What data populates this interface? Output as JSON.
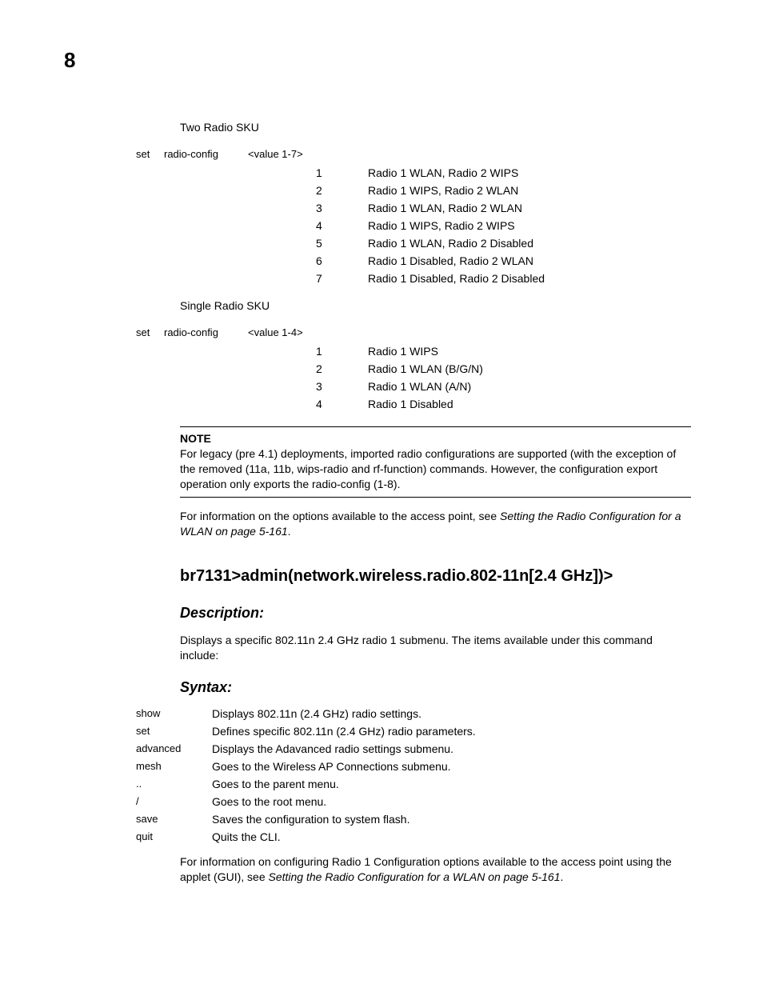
{
  "page_number": "8",
  "section1": {
    "title": "Two Radio SKU",
    "cmd": {
      "set": "set",
      "rc": "radio-config",
      "range": "<value 1-7>"
    },
    "values": [
      {
        "n": "1",
        "d": "Radio 1 WLAN, Radio 2 WIPS"
      },
      {
        "n": "2",
        "d": "Radio 1 WIPS, Radio 2 WLAN"
      },
      {
        "n": "3",
        "d": "Radio 1 WLAN, Radio 2 WLAN"
      },
      {
        "n": "4",
        "d": "Radio 1 WIPS, Radio 2 WIPS"
      },
      {
        "n": "5",
        "d": "Radio 1 WLAN, Radio 2 Disabled"
      },
      {
        "n": "6",
        "d": "Radio 1 Disabled, Radio 2 WLAN"
      },
      {
        "n": "7",
        "d": "Radio 1 Disabled, Radio 2 Disabled"
      }
    ]
  },
  "section2": {
    "title": "Single Radio SKU",
    "cmd": {
      "set": "set",
      "rc": "radio-config",
      "range": "<value 1-4>"
    },
    "values": [
      {
        "n": "1",
        "d": "Radio 1 WIPS"
      },
      {
        "n": "2",
        "d": "Radio 1 WLAN (B/G/N)"
      },
      {
        "n": "3",
        "d": "Radio 1 WLAN (A/N)"
      },
      {
        "n": "4",
        "d": "Radio 1 Disabled"
      }
    ]
  },
  "note": {
    "label": "NOTE",
    "text": "For legacy (pre 4.1) deployments, imported radio configurations are supported (with the exception of the removed (11a, 11b, wips-radio and rf-function) commands. However, the configuration export operation only exports the radio-config (1-8)."
  },
  "ref1": {
    "pre": "For information on the options available to the access point, see ",
    "ital": "Setting the Radio Configuration for a WLAN on page 5-161",
    "post": "."
  },
  "cmd_heading": "br7131>admin(network.wireless.radio.802-11n[2.4 GHz])>",
  "desc_heading": "Description:",
  "desc_text": "Displays a specific 802.11n 2.4 GHz radio 1 submenu. The items available under this command include:",
  "syntax_heading": "Syntax:",
  "syntax": [
    {
      "c": "show",
      "d": "Displays 802.11n (2.4 GHz) radio settings."
    },
    {
      "c": "set",
      "d": "Defines specific 802.11n (2.4 GHz) radio parameters."
    },
    {
      "c": "advanced",
      "d": "Displays the Adavanced radio settings submenu."
    },
    {
      "c": "mesh",
      "d": "Goes to the Wireless AP Connections submenu."
    },
    {
      "c": "..",
      "d": "Goes to the parent menu."
    },
    {
      "c": "/",
      "d": "Goes to the root menu."
    },
    {
      "c": "save",
      "d": "Saves the configuration to system flash."
    },
    {
      "c": "quit",
      "d": "Quits the CLI."
    }
  ],
  "ref2": {
    "pre": "For information on configuring Radio 1 Configuration options available to the access point using the applet (GUI), see ",
    "ital": "Setting the Radio Configuration for a WLAN on page 5-161",
    "post": "."
  }
}
